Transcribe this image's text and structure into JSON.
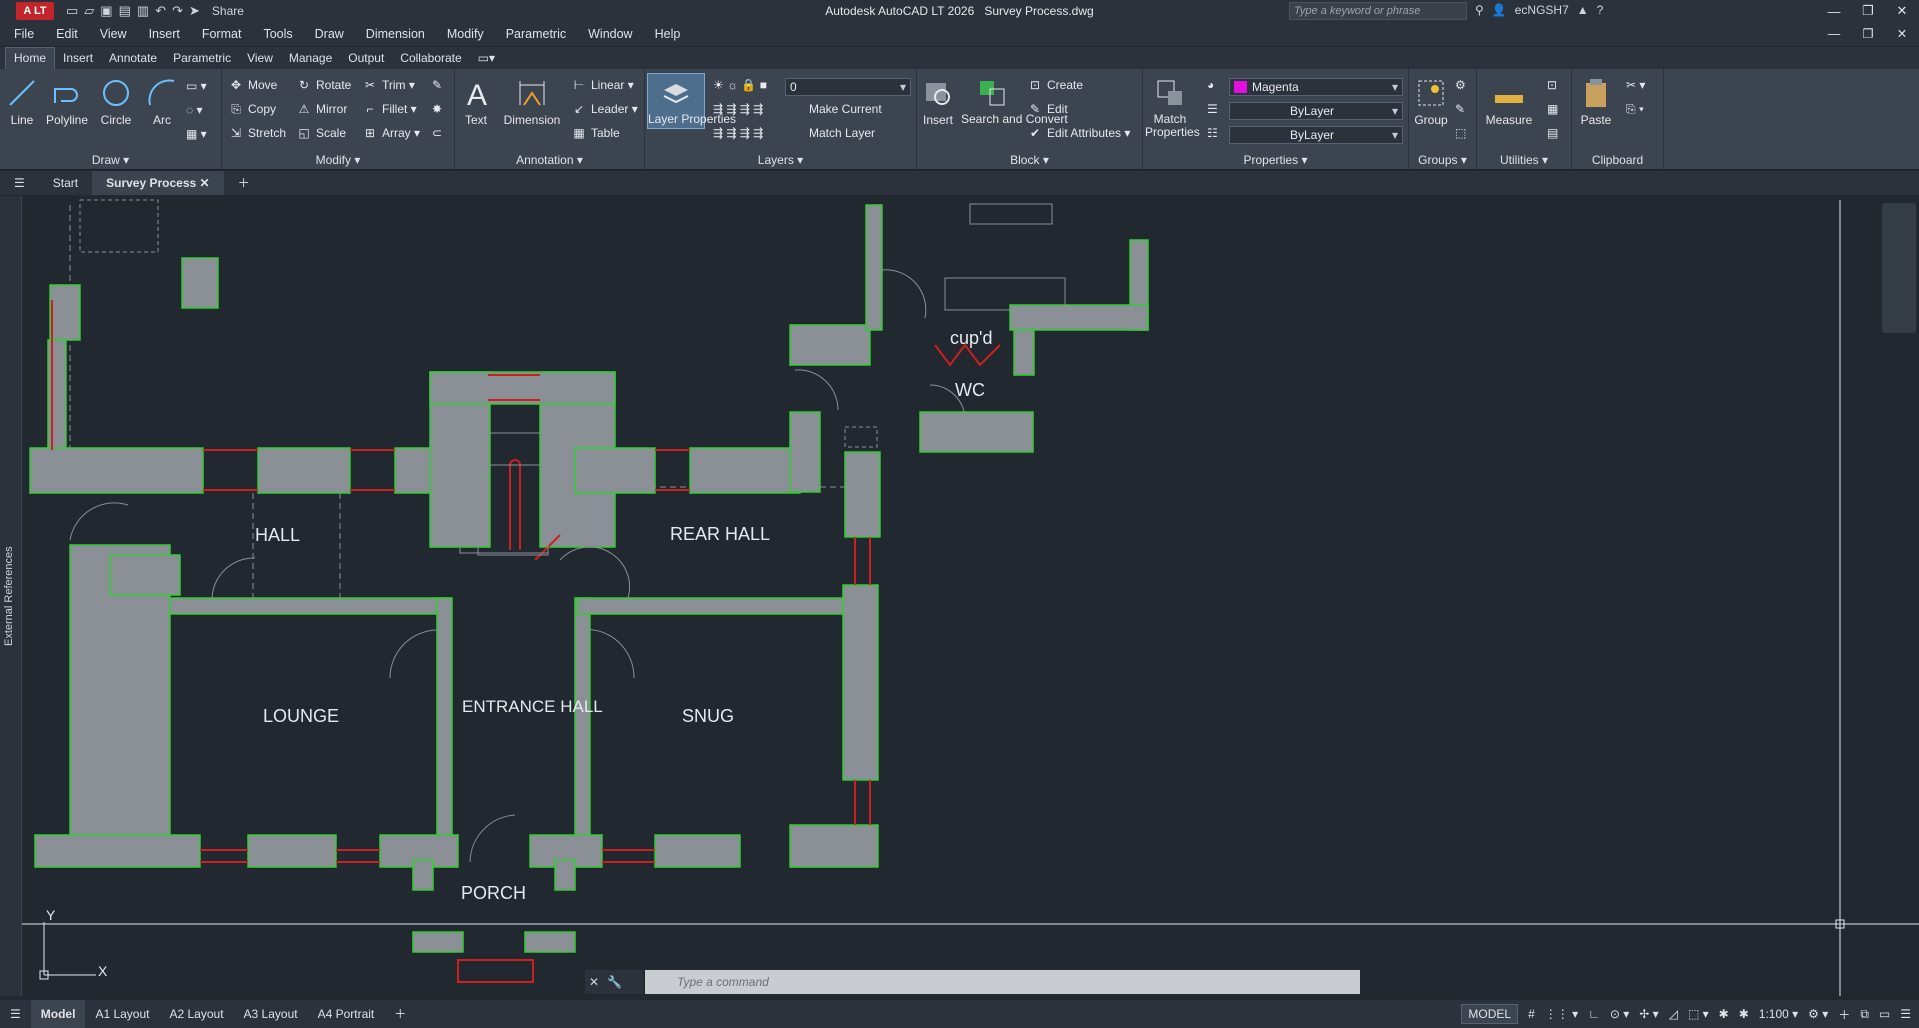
{
  "app": {
    "badge": "A LT",
    "title": "Autodesk AutoCAD LT 2026",
    "document": "Survey Process.dwg",
    "share_label": "Share",
    "search_placeholder": "Type a keyword or phrase",
    "user": "ecNGSH7"
  },
  "menus": [
    "File",
    "Edit",
    "View",
    "Insert",
    "Format",
    "Tools",
    "Draw",
    "Dimension",
    "Modify",
    "Parametric",
    "Window",
    "Help"
  ],
  "ribbon_tabs": [
    "Home",
    "Insert",
    "Annotate",
    "Parametric",
    "View",
    "Manage",
    "Output",
    "Collaborate"
  ],
  "active_ribbon_tab": "Home",
  "panels": {
    "draw": {
      "label": "Draw",
      "tools": [
        "Line",
        "Polyline",
        "Circle",
        "Arc"
      ]
    },
    "modify": {
      "label": "Modify",
      "tools": [
        "Move",
        "Rotate",
        "Trim",
        "Copy",
        "Mirror",
        "Fillet",
        "Stretch",
        "Scale",
        "Array"
      ]
    },
    "annotation": {
      "label": "Annotation",
      "tools": [
        "Text",
        "Dimension",
        "Linear",
        "Leader",
        "Table"
      ]
    },
    "layers": {
      "label": "Layers",
      "layer_properties": "Layer Properties",
      "current_layer": "0",
      "make_current": "Make Current",
      "match_layer": "Match Layer"
    },
    "block": {
      "label": "Block",
      "insert": "Insert",
      "search_convert": "Search and Convert",
      "create": "Create",
      "edit": "Edit",
      "edit_attributes": "Edit Attributes"
    },
    "properties": {
      "label": "Properties",
      "match": "Match Properties",
      "color": "Magenta",
      "color_hex": "#e010e0",
      "linetype": "ByLayer",
      "lineweight": "ByLayer"
    },
    "groups": {
      "label": "Groups",
      "group": "Group"
    },
    "utilities": {
      "label": "Utilities",
      "measure": "Measure"
    },
    "clipboard": {
      "label": "Clipboard",
      "paste": "Paste"
    }
  },
  "doc_tabs": {
    "start": "Start",
    "active": "Survey Process"
  },
  "side_palette": "External References",
  "rooms": [
    "cup'd",
    "WC",
    "HALL",
    "REAR HALL",
    "LOUNGE",
    "ENTRANCE HALL",
    "SNUG",
    "PORCH"
  ],
  "ucs": {
    "x": "X",
    "y": "Y"
  },
  "command_placeholder": "Type a command",
  "layout_tabs": [
    "Model",
    "A1 Layout",
    "A2 Layout",
    "A3 Layout",
    "A4 Portrait"
  ],
  "status": {
    "model": "MODEL",
    "scale": "1:100"
  },
  "colors": {
    "wall_fill": "#8b8f96",
    "wall_outline": "#33cc33",
    "window": "#cc2020",
    "background": "#212830"
  }
}
